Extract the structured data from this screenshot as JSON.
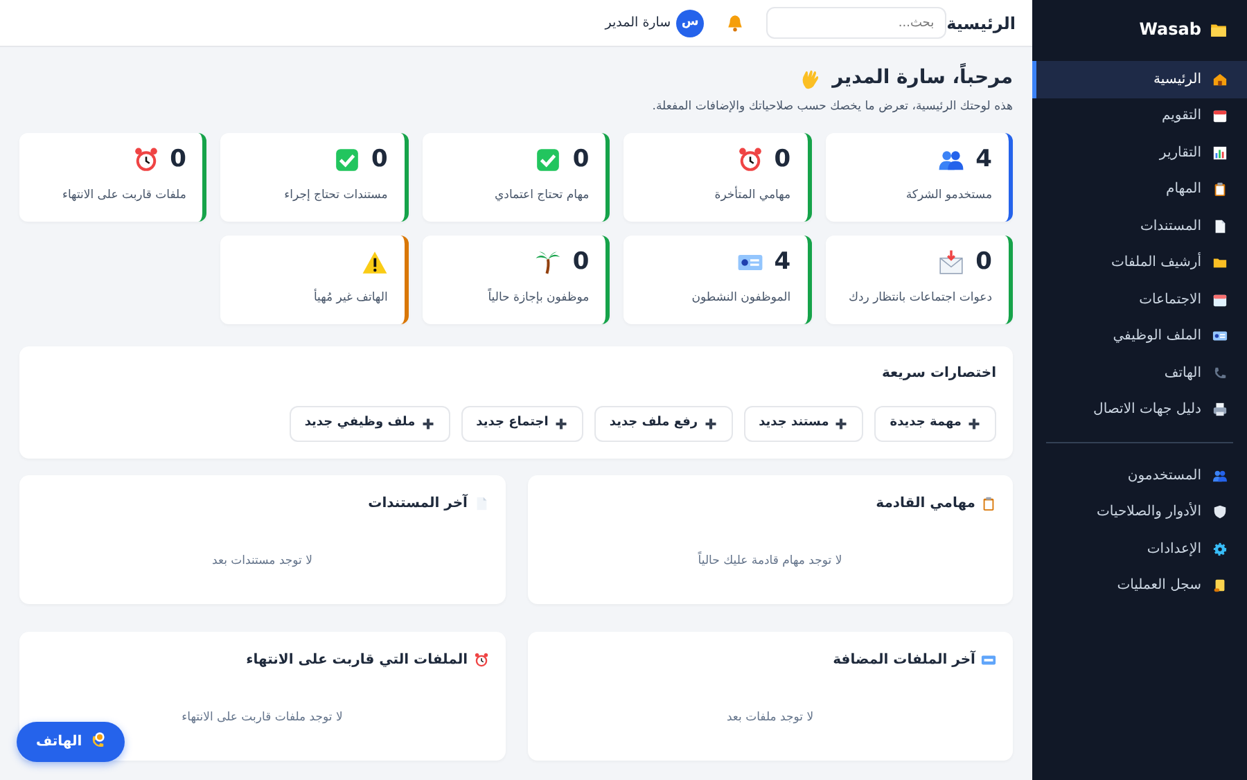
{
  "sidebar": {
    "brand": "Wasab",
    "sections": [
      {
        "items": [
          {
            "label": "الرئيسية",
            "selected": true
          },
          {
            "label": "التقويم",
            "selected": false
          },
          {
            "label": "التقارير",
            "selected": false
          },
          {
            "label": "المهام",
            "selected": false
          },
          {
            "label": "المستندات",
            "selected": false
          },
          {
            "label": "أرشيف الملفات",
            "selected": false
          },
          {
            "label": "الاجتماعات",
            "selected": false
          },
          {
            "label": "الملف الوظيفي",
            "selected": false
          },
          {
            "label": "الهاتف",
            "selected": false
          },
          {
            "label": "دليل جهات الاتصال",
            "selected": false
          }
        ]
      },
      {
        "items": [
          {
            "label": "المستخدمون",
            "selected": false
          },
          {
            "label": "الأدوار والصلاحيات",
            "selected": false
          },
          {
            "label": "الإعدادات",
            "selected": false
          },
          {
            "label": "سجل العمليات",
            "selected": false
          }
        ]
      }
    ]
  },
  "header": {
    "title": "الرئيسية",
    "search": {
      "placeholder": "بحث..."
    },
    "user": {
      "initial": "س",
      "name": "سارة المدير"
    }
  },
  "welcome": {
    "title": "مرحباً، سارة المدير",
    "subtitle": "هذه لوحتك الرئيسية، تعرض ما يخصك حسب صلاحياتك والإضافات المفعلة."
  },
  "stats": [
    {
      "value": "4",
      "label": "مستخدمو الشركة",
      "color": "#2563eb"
    },
    {
      "value": "0",
      "label": "مهامي المتأخرة",
      "color": "#16a34a"
    },
    {
      "value": "0",
      "label": "مهام تحتاج اعتمادي",
      "color": "#16a34a"
    },
    {
      "value": "0",
      "label": "مستندات تحتاج إجراء",
      "color": "#16a34a"
    },
    {
      "value": "0",
      "label": "ملفات قاربت على الانتهاء",
      "color": "#16a34a"
    },
    {
      "value": "0",
      "label": "دعوات اجتماعات بانتظار ردك",
      "color": "#16a34a"
    },
    {
      "value": "4",
      "label": "الموظفون النشطون",
      "color": "#16a34a"
    },
    {
      "value": "0",
      "label": "موظفون بإجازة حالياً",
      "color": "#16a34a"
    },
    {
      "label": "الهاتف غير مُهيأ",
      "color": "#d97706"
    }
  ],
  "shortcuts": {
    "title": "اختصارات سريعة",
    "buttons": [
      "مهمة جديدة",
      "مستند جديد",
      "رفع ملف جديد",
      "اجتماع جديد",
      "ملف وظيفي جديد"
    ]
  },
  "panels": [
    {
      "title": "مهامي القادمة",
      "empty": "لا توجد مهام قادمة عليك حالياً"
    },
    {
      "title": "آخر المستندات",
      "empty": "لا توجد مستندات بعد"
    },
    {
      "title": "آخر الملفات المضافة",
      "empty": "لا توجد ملفات بعد"
    },
    {
      "title": "الملفات التي قاربت على الانتهاء",
      "empty": "لا توجد ملفات قاربت على الانتهاء"
    }
  ],
  "phone_button": {
    "label": "الهاتف"
  }
}
